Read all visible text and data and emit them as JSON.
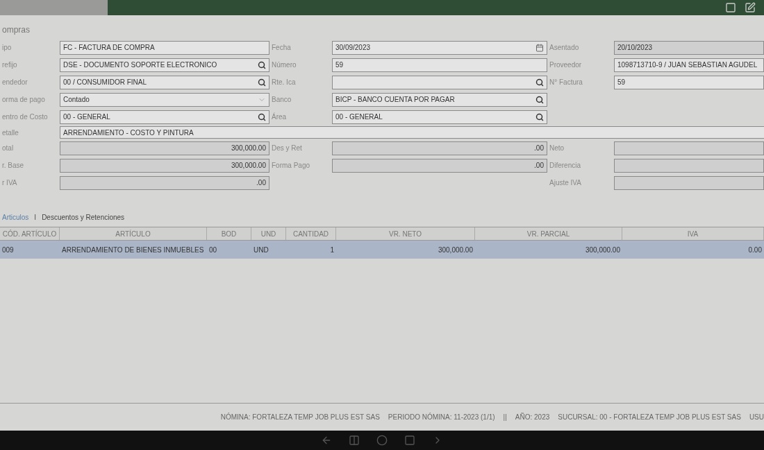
{
  "section_title": "ompras",
  "form_rows": [
    [
      {
        "label": "ipo",
        "kind": "text",
        "value": "FC - FACTURA DE COMPRA"
      },
      {
        "label": "Fecha",
        "kind": "date",
        "value": "30/09/2023"
      },
      {
        "label": "Asentado",
        "kind": "amount",
        "value": "20/10/2023"
      }
    ],
    [
      {
        "label": "refijo",
        "kind": "search",
        "value": "DSE - DOCUMENTO SOPORTE ELECTRONICO"
      },
      {
        "label": "Número",
        "kind": "text",
        "value": "59"
      },
      {
        "label": "Proveedor",
        "kind": "text",
        "value": "1098713710-9 / JUAN SEBASTIAN AGUDEL"
      }
    ],
    [
      {
        "label": "endedor",
        "kind": "search",
        "value": "00 / CONSUMIDOR FINAL"
      },
      {
        "label": "Rte. Ica",
        "kind": "search"
      },
      {
        "label": "N° Factura",
        "kind": "text",
        "value": "59"
      }
    ],
    [
      {
        "label": "orma de pago",
        "kind": "select",
        "value": "Contado"
      },
      {
        "label": "Banco",
        "kind": "search",
        "value": "BICP - BANCO CUENTA POR PAGAR"
      }
    ],
    [
      {
        "label": "entro de Costo",
        "kind": "search",
        "value": "00 - GENERAL"
      },
      {
        "label": "Área",
        "kind": "search",
        "value": "00 - GENERAL"
      }
    ]
  ],
  "detail": {
    "label": "etalle",
    "value": "ARRENDAMIENTO - COSTO Y PINTURA"
  },
  "total_rows": [
    [
      {
        "label": "otal",
        "kind": "amount",
        "value": "300,000.00"
      },
      {
        "label": "Des y Ret",
        "kind": "amount",
        "value": ".00"
      },
      {
        "label": "Neto",
        "kind": "amount"
      }
    ],
    [
      {
        "label": "r. Base",
        "kind": "amount",
        "value": "300,000.00"
      },
      {
        "label": "Forma Pago",
        "kind": "amount",
        "value": ".00"
      },
      {
        "label": "Diferencia",
        "kind": "amount"
      }
    ],
    [
      {
        "label": "r IVA",
        "kind": "amount",
        "value": ".00"
      },
      null,
      {
        "label": "Ajuste IVA",
        "kind": "amount"
      }
    ]
  ],
  "tabs": [
    {
      "label": "Articulos",
      "selected": true
    },
    {
      "label": "Descuentos y Retenciones",
      "selected": false
    }
  ],
  "tab_separator": "I",
  "table": {
    "columns": [
      "CÓD. ARTÍCULO",
      "ARTÍCULO",
      "BOD",
      "UND",
      "CANTIDAD",
      "VR. NETO",
      "VR. PARCIAL",
      "IVA"
    ],
    "rows": [
      {
        "selected": true,
        "cells": [
          "009",
          "ARRENDAMIENTO DE BIENES INMUEBLES",
          "00",
          "UND",
          "1",
          "300,000.00",
          "300,000.00",
          "0.00"
        ]
      }
    ]
  },
  "status_bar": [
    "NÓMINA: FORTALEZA TEMP JOB PLUS EST SAS",
    "PERIODO NÓMINA: 11-2023 (1/1)",
    "||",
    "AÑO: 2023",
    "SUCURSAL: 00 - FORTALEZA TEMP JOB PLUS EST SAS",
    "USU"
  ]
}
